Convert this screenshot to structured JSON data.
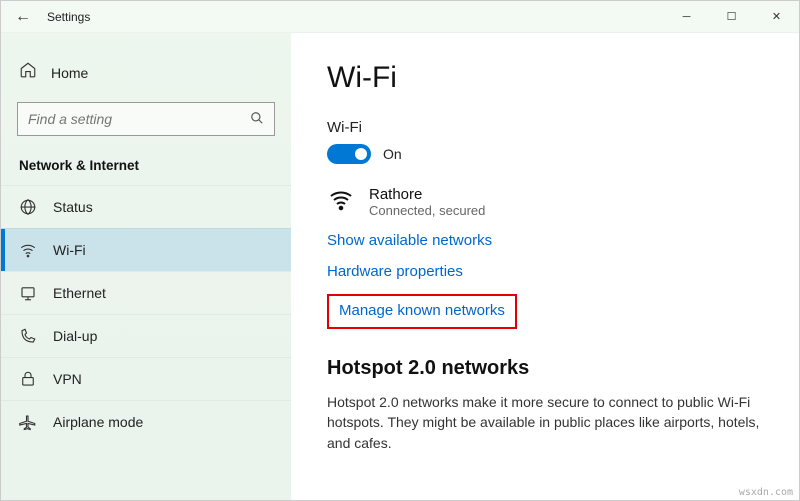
{
  "window": {
    "title": "Settings"
  },
  "sidebar": {
    "home": "Home",
    "search_placeholder": "Find a setting",
    "section": "Network & Internet",
    "items": [
      {
        "label": "Status"
      },
      {
        "label": "Wi-Fi"
      },
      {
        "label": "Ethernet"
      },
      {
        "label": "Dial-up"
      },
      {
        "label": "VPN"
      },
      {
        "label": "Airplane mode"
      }
    ]
  },
  "main": {
    "title": "Wi-Fi",
    "toggle_label": "Wi-Fi",
    "toggle_state": "On",
    "network": {
      "name": "Rathore",
      "status": "Connected, secured"
    },
    "links": {
      "show_available": "Show available networks",
      "hw_props": "Hardware properties",
      "manage_known": "Manage known networks"
    },
    "hotspot": {
      "title": "Hotspot 2.0 networks",
      "body": "Hotspot 2.0 networks make it more secure to connect to public Wi-Fi hotspots. They might be available in public places like airports, hotels, and cafes."
    }
  },
  "watermark": "wsxdn.com"
}
